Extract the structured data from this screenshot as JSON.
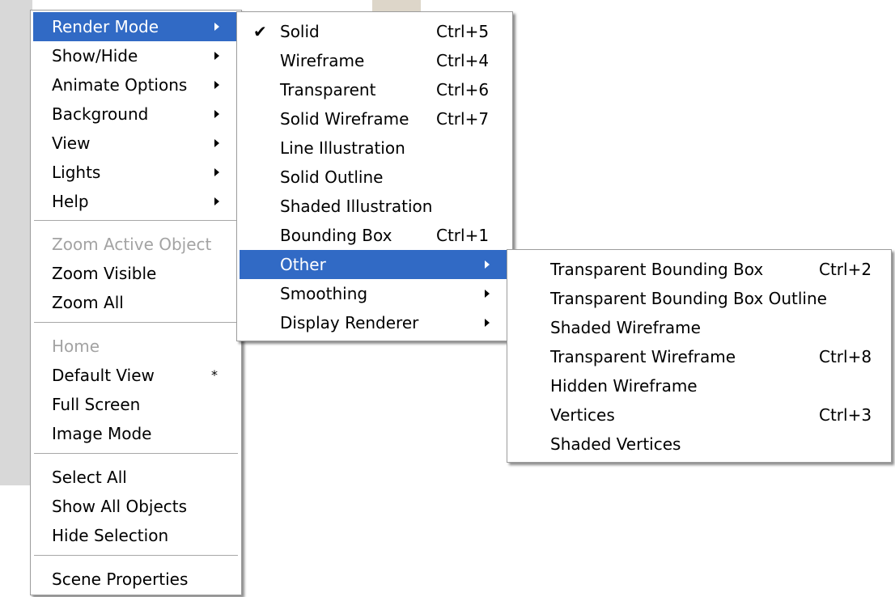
{
  "main_menu": {
    "items": [
      {
        "label": "Render Mode"
      },
      {
        "label": "Show/Hide"
      },
      {
        "label": "Animate Options"
      },
      {
        "label": "Background"
      },
      {
        "label": "View"
      },
      {
        "label": "Lights"
      },
      {
        "label": "Help"
      },
      {
        "label": "Zoom Active Object"
      },
      {
        "label": "Zoom Visible"
      },
      {
        "label": "Zoom All"
      },
      {
        "label": "Home"
      },
      {
        "label": "Default View",
        "shortcut": "*"
      },
      {
        "label": "Full Screen"
      },
      {
        "label": "Image Mode"
      },
      {
        "label": "Select All"
      },
      {
        "label": "Show All Objects"
      },
      {
        "label": "Hide Selection"
      },
      {
        "label": "Scene Properties"
      }
    ]
  },
  "render_mode_menu": {
    "check_glyph": "✔",
    "items": [
      {
        "label": "Solid",
        "shortcut": "Ctrl+5",
        "checked": true
      },
      {
        "label": "Wireframe",
        "shortcut": "Ctrl+4"
      },
      {
        "label": "Transparent",
        "shortcut": "Ctrl+6"
      },
      {
        "label": "Solid Wireframe",
        "shortcut": "Ctrl+7"
      },
      {
        "label": "Line Illustration"
      },
      {
        "label": "Solid Outline"
      },
      {
        "label": "Shaded Illustration"
      },
      {
        "label": "Bounding Box",
        "shortcut": "Ctrl+1"
      },
      {
        "label": "Other"
      },
      {
        "label": "Smoothing"
      },
      {
        "label": "Display Renderer"
      }
    ]
  },
  "other_menu": {
    "items": [
      {
        "label": "Transparent Bounding Box",
        "shortcut": "Ctrl+2"
      },
      {
        "label": "Transparent Bounding Box Outline"
      },
      {
        "label": "Shaded Wireframe"
      },
      {
        "label": "Transparent Wireframe",
        "shortcut": "Ctrl+8"
      },
      {
        "label": "Hidden Wireframe"
      },
      {
        "label": "Vertices",
        "shortcut": "Ctrl+3"
      },
      {
        "label": "Shaded Vertices"
      }
    ]
  },
  "colors": {
    "highlight": "#316ac5",
    "disabled_text": "#a3a3a3",
    "menu_border": "#9c9c9c"
  }
}
